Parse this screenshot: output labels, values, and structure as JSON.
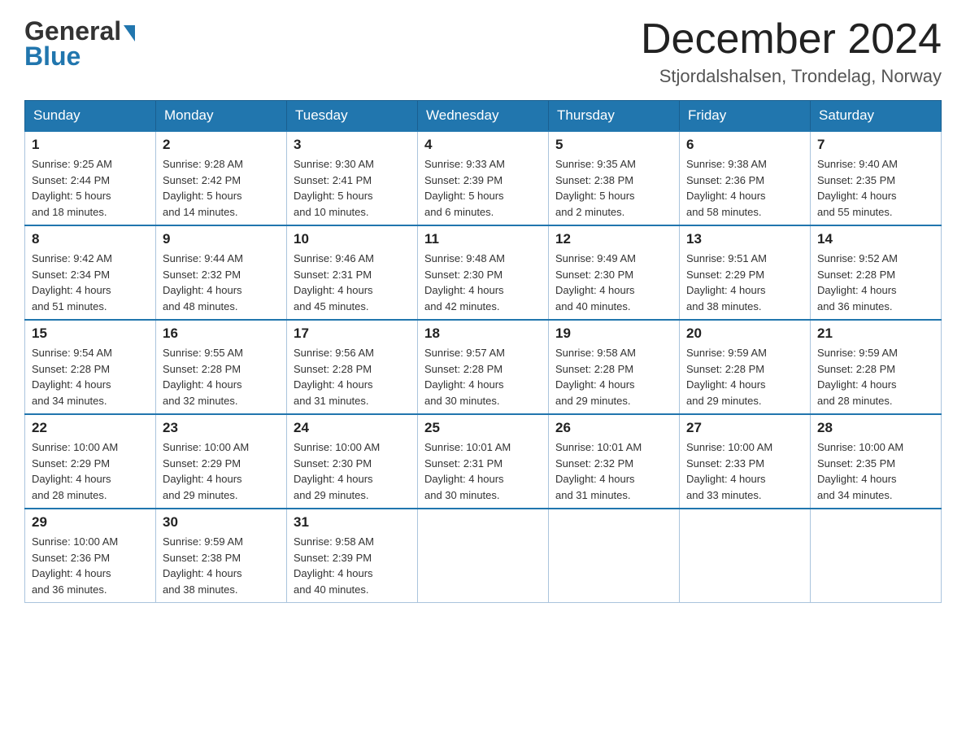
{
  "header": {
    "logo_general": "General",
    "logo_blue": "Blue",
    "month_title": "December 2024",
    "location": "Stjordalshalsen, Trondelag, Norway"
  },
  "days_of_week": [
    "Sunday",
    "Monday",
    "Tuesday",
    "Wednesday",
    "Thursday",
    "Friday",
    "Saturday"
  ],
  "weeks": [
    [
      {
        "day": "1",
        "sunrise": "Sunrise: 9:25 AM",
        "sunset": "Sunset: 2:44 PM",
        "daylight": "Daylight: 5 hours",
        "daylight2": "and 18 minutes."
      },
      {
        "day": "2",
        "sunrise": "Sunrise: 9:28 AM",
        "sunset": "Sunset: 2:42 PM",
        "daylight": "Daylight: 5 hours",
        "daylight2": "and 14 minutes."
      },
      {
        "day": "3",
        "sunrise": "Sunrise: 9:30 AM",
        "sunset": "Sunset: 2:41 PM",
        "daylight": "Daylight: 5 hours",
        "daylight2": "and 10 minutes."
      },
      {
        "day": "4",
        "sunrise": "Sunrise: 9:33 AM",
        "sunset": "Sunset: 2:39 PM",
        "daylight": "Daylight: 5 hours",
        "daylight2": "and 6 minutes."
      },
      {
        "day": "5",
        "sunrise": "Sunrise: 9:35 AM",
        "sunset": "Sunset: 2:38 PM",
        "daylight": "Daylight: 5 hours",
        "daylight2": "and 2 minutes."
      },
      {
        "day": "6",
        "sunrise": "Sunrise: 9:38 AM",
        "sunset": "Sunset: 2:36 PM",
        "daylight": "Daylight: 4 hours",
        "daylight2": "and 58 minutes."
      },
      {
        "day": "7",
        "sunrise": "Sunrise: 9:40 AM",
        "sunset": "Sunset: 2:35 PM",
        "daylight": "Daylight: 4 hours",
        "daylight2": "and 55 minutes."
      }
    ],
    [
      {
        "day": "8",
        "sunrise": "Sunrise: 9:42 AM",
        "sunset": "Sunset: 2:34 PM",
        "daylight": "Daylight: 4 hours",
        "daylight2": "and 51 minutes."
      },
      {
        "day": "9",
        "sunrise": "Sunrise: 9:44 AM",
        "sunset": "Sunset: 2:32 PM",
        "daylight": "Daylight: 4 hours",
        "daylight2": "and 48 minutes."
      },
      {
        "day": "10",
        "sunrise": "Sunrise: 9:46 AM",
        "sunset": "Sunset: 2:31 PM",
        "daylight": "Daylight: 4 hours",
        "daylight2": "and 45 minutes."
      },
      {
        "day": "11",
        "sunrise": "Sunrise: 9:48 AM",
        "sunset": "Sunset: 2:30 PM",
        "daylight": "Daylight: 4 hours",
        "daylight2": "and 42 minutes."
      },
      {
        "day": "12",
        "sunrise": "Sunrise: 9:49 AM",
        "sunset": "Sunset: 2:30 PM",
        "daylight": "Daylight: 4 hours",
        "daylight2": "and 40 minutes."
      },
      {
        "day": "13",
        "sunrise": "Sunrise: 9:51 AM",
        "sunset": "Sunset: 2:29 PM",
        "daylight": "Daylight: 4 hours",
        "daylight2": "and 38 minutes."
      },
      {
        "day": "14",
        "sunrise": "Sunrise: 9:52 AM",
        "sunset": "Sunset: 2:28 PM",
        "daylight": "Daylight: 4 hours",
        "daylight2": "and 36 minutes."
      }
    ],
    [
      {
        "day": "15",
        "sunrise": "Sunrise: 9:54 AM",
        "sunset": "Sunset: 2:28 PM",
        "daylight": "Daylight: 4 hours",
        "daylight2": "and 34 minutes."
      },
      {
        "day": "16",
        "sunrise": "Sunrise: 9:55 AM",
        "sunset": "Sunset: 2:28 PM",
        "daylight": "Daylight: 4 hours",
        "daylight2": "and 32 minutes."
      },
      {
        "day": "17",
        "sunrise": "Sunrise: 9:56 AM",
        "sunset": "Sunset: 2:28 PM",
        "daylight": "Daylight: 4 hours",
        "daylight2": "and 31 minutes."
      },
      {
        "day": "18",
        "sunrise": "Sunrise: 9:57 AM",
        "sunset": "Sunset: 2:28 PM",
        "daylight": "Daylight: 4 hours",
        "daylight2": "and 30 minutes."
      },
      {
        "day": "19",
        "sunrise": "Sunrise: 9:58 AM",
        "sunset": "Sunset: 2:28 PM",
        "daylight": "Daylight: 4 hours",
        "daylight2": "and 29 minutes."
      },
      {
        "day": "20",
        "sunrise": "Sunrise: 9:59 AM",
        "sunset": "Sunset: 2:28 PM",
        "daylight": "Daylight: 4 hours",
        "daylight2": "and 29 minutes."
      },
      {
        "day": "21",
        "sunrise": "Sunrise: 9:59 AM",
        "sunset": "Sunset: 2:28 PM",
        "daylight": "Daylight: 4 hours",
        "daylight2": "and 28 minutes."
      }
    ],
    [
      {
        "day": "22",
        "sunrise": "Sunrise: 10:00 AM",
        "sunset": "Sunset: 2:29 PM",
        "daylight": "Daylight: 4 hours",
        "daylight2": "and 28 minutes."
      },
      {
        "day": "23",
        "sunrise": "Sunrise: 10:00 AM",
        "sunset": "Sunset: 2:29 PM",
        "daylight": "Daylight: 4 hours",
        "daylight2": "and 29 minutes."
      },
      {
        "day": "24",
        "sunrise": "Sunrise: 10:00 AM",
        "sunset": "Sunset: 2:30 PM",
        "daylight": "Daylight: 4 hours",
        "daylight2": "and 29 minutes."
      },
      {
        "day": "25",
        "sunrise": "Sunrise: 10:01 AM",
        "sunset": "Sunset: 2:31 PM",
        "daylight": "Daylight: 4 hours",
        "daylight2": "and 30 minutes."
      },
      {
        "day": "26",
        "sunrise": "Sunrise: 10:01 AM",
        "sunset": "Sunset: 2:32 PM",
        "daylight": "Daylight: 4 hours",
        "daylight2": "and 31 minutes."
      },
      {
        "day": "27",
        "sunrise": "Sunrise: 10:00 AM",
        "sunset": "Sunset: 2:33 PM",
        "daylight": "Daylight: 4 hours",
        "daylight2": "and 33 minutes."
      },
      {
        "day": "28",
        "sunrise": "Sunrise: 10:00 AM",
        "sunset": "Sunset: 2:35 PM",
        "daylight": "Daylight: 4 hours",
        "daylight2": "and 34 minutes."
      }
    ],
    [
      {
        "day": "29",
        "sunrise": "Sunrise: 10:00 AM",
        "sunset": "Sunset: 2:36 PM",
        "daylight": "Daylight: 4 hours",
        "daylight2": "and 36 minutes."
      },
      {
        "day": "30",
        "sunrise": "Sunrise: 9:59 AM",
        "sunset": "Sunset: 2:38 PM",
        "daylight": "Daylight: 4 hours",
        "daylight2": "and 38 minutes."
      },
      {
        "day": "31",
        "sunrise": "Sunrise: 9:58 AM",
        "sunset": "Sunset: 2:39 PM",
        "daylight": "Daylight: 4 hours",
        "daylight2": "and 40 minutes."
      },
      null,
      null,
      null,
      null
    ]
  ]
}
